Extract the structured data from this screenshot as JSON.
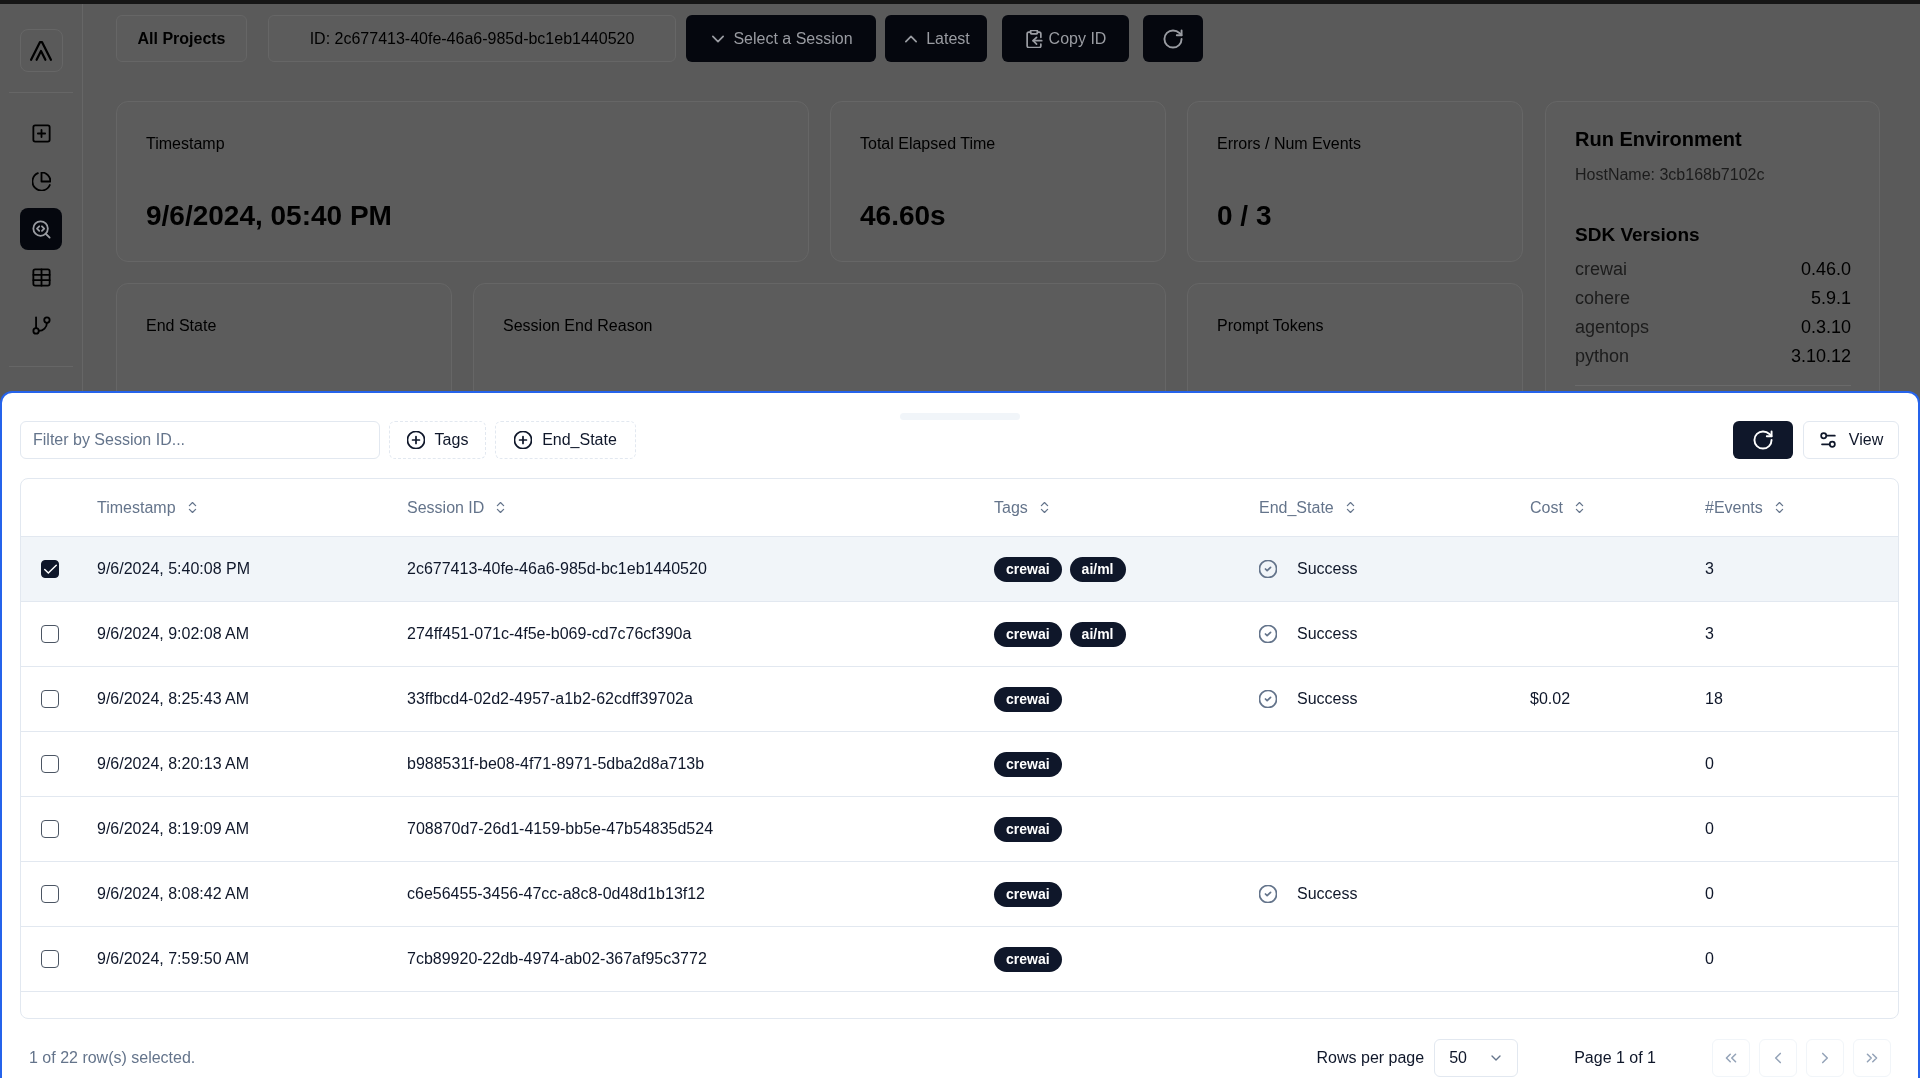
{
  "sidebar": {
    "items": [
      {
        "selected": false
      },
      {
        "selected": false
      },
      {
        "selected": true
      },
      {
        "selected": false
      },
      {
        "selected": false
      }
    ]
  },
  "header": {
    "project_button": "All Projects",
    "session_id": "ID: 2c677413-40fe-46a6-985d-bc1eb1440520",
    "buttons": [
      {
        "kind": "dropdown",
        "label": "Select a Session"
      },
      {
        "kind": "latest",
        "label": "Latest"
      },
      {
        "kind": "copy",
        "label": "Copy ID"
      },
      {
        "kind": "refresh"
      }
    ]
  },
  "stats": [
    {
      "label": "Timestamp",
      "value": "9/6/2024, 05:40 PM"
    },
    {
      "label": "Total Elapsed Time",
      "value": "46.60s"
    },
    {
      "label": "Errors / Num Events",
      "value": "0 / 3"
    },
    {
      "label": "End State"
    },
    {
      "label": "Session End Reason"
    },
    {
      "label": "Prompt Tokens"
    }
  ],
  "run_environment": {
    "title": "Run Environment",
    "hostname": "HostName: 3cb168b7102c",
    "sdk_title": "SDK Versions",
    "sdk_versions": [
      {
        "name": "crewai",
        "version": "0.46.0"
      },
      {
        "name": "cohere",
        "version": "5.9.1"
      },
      {
        "name": "agentops",
        "version": "0.3.10"
      },
      {
        "name": "python",
        "version": "3.10.12"
      }
    ]
  },
  "sessions_drawer": {
    "filter": {
      "placeholder": "Filter by Session ID..."
    },
    "filter_buttons": [
      "Tags",
      "End_State"
    ],
    "view_button": "View",
    "table": {
      "columns": [
        "Timestamp",
        "Session ID",
        "Tags",
        "End_State",
        "Cost",
        "#Events"
      ],
      "rows": [
        {
          "selected": true,
          "timestamp": "9/6/2024, 5:40:08 PM",
          "session_id": "2c677413-40fe-46a6-985d-bc1eb1440520",
          "tags": [
            "crewai",
            "ai/ml"
          ],
          "end_state": {
            "kind": "success",
            "label": "Success"
          },
          "events": "3"
        },
        {
          "selected": false,
          "timestamp": "9/6/2024, 9:02:08 AM",
          "session_id": "274ff451-071c-4f5e-b069-cd7c76cf390a",
          "tags": [
            "crewai",
            "ai/ml"
          ],
          "end_state": {
            "kind": "success",
            "label": "Success"
          },
          "events": "3"
        },
        {
          "selected": false,
          "timestamp": "9/6/2024, 8:25:43 AM",
          "session_id": "33ffbcd4-02d2-4957-a1b2-62cdff39702a",
          "tags": [
            "crewai"
          ],
          "end_state": {
            "kind": "success",
            "label": "Success"
          },
          "cost": "$0.02",
          "events": "18"
        },
        {
          "selected": false,
          "timestamp": "9/6/2024, 8:20:13 AM",
          "session_id": "b988531f-be08-4f71-8971-5dba2d8a713b",
          "tags": [
            "crewai"
          ],
          "events": "0"
        },
        {
          "selected": false,
          "timestamp": "9/6/2024, 8:19:09 AM",
          "session_id": "708870d7-26d1-4159-bb5e-47b54835d524",
          "tags": [
            "crewai"
          ],
          "events": "0"
        },
        {
          "selected": false,
          "timestamp": "9/6/2024, 8:08:42 AM",
          "session_id": "c6e56455-3456-47cc-a8c8-0d48d1b13f12",
          "tags": [
            "crewai"
          ],
          "end_state": {
            "kind": "success",
            "label": "Success"
          },
          "events": "0"
        },
        {
          "selected": false,
          "timestamp": "9/6/2024, 7:59:50 AM",
          "session_id": "7cb89920-22db-4974-ab02-367af95c3772",
          "tags": [
            "crewai"
          ],
          "events": "0"
        }
      ]
    },
    "footer": {
      "selection": "1 of 22 row(s) selected.",
      "rows_per_page_label": "Rows per page",
      "rows_per_page_value": "50",
      "page": "Page 1 of 1",
      "pager": [
        {
          "kind": "first",
          "disabled": true
        },
        {
          "kind": "previous",
          "disabled": true
        },
        {
          "kind": "next",
          "disabled": true
        },
        {
          "kind": "last",
          "disabled": true
        }
      ]
    }
  }
}
